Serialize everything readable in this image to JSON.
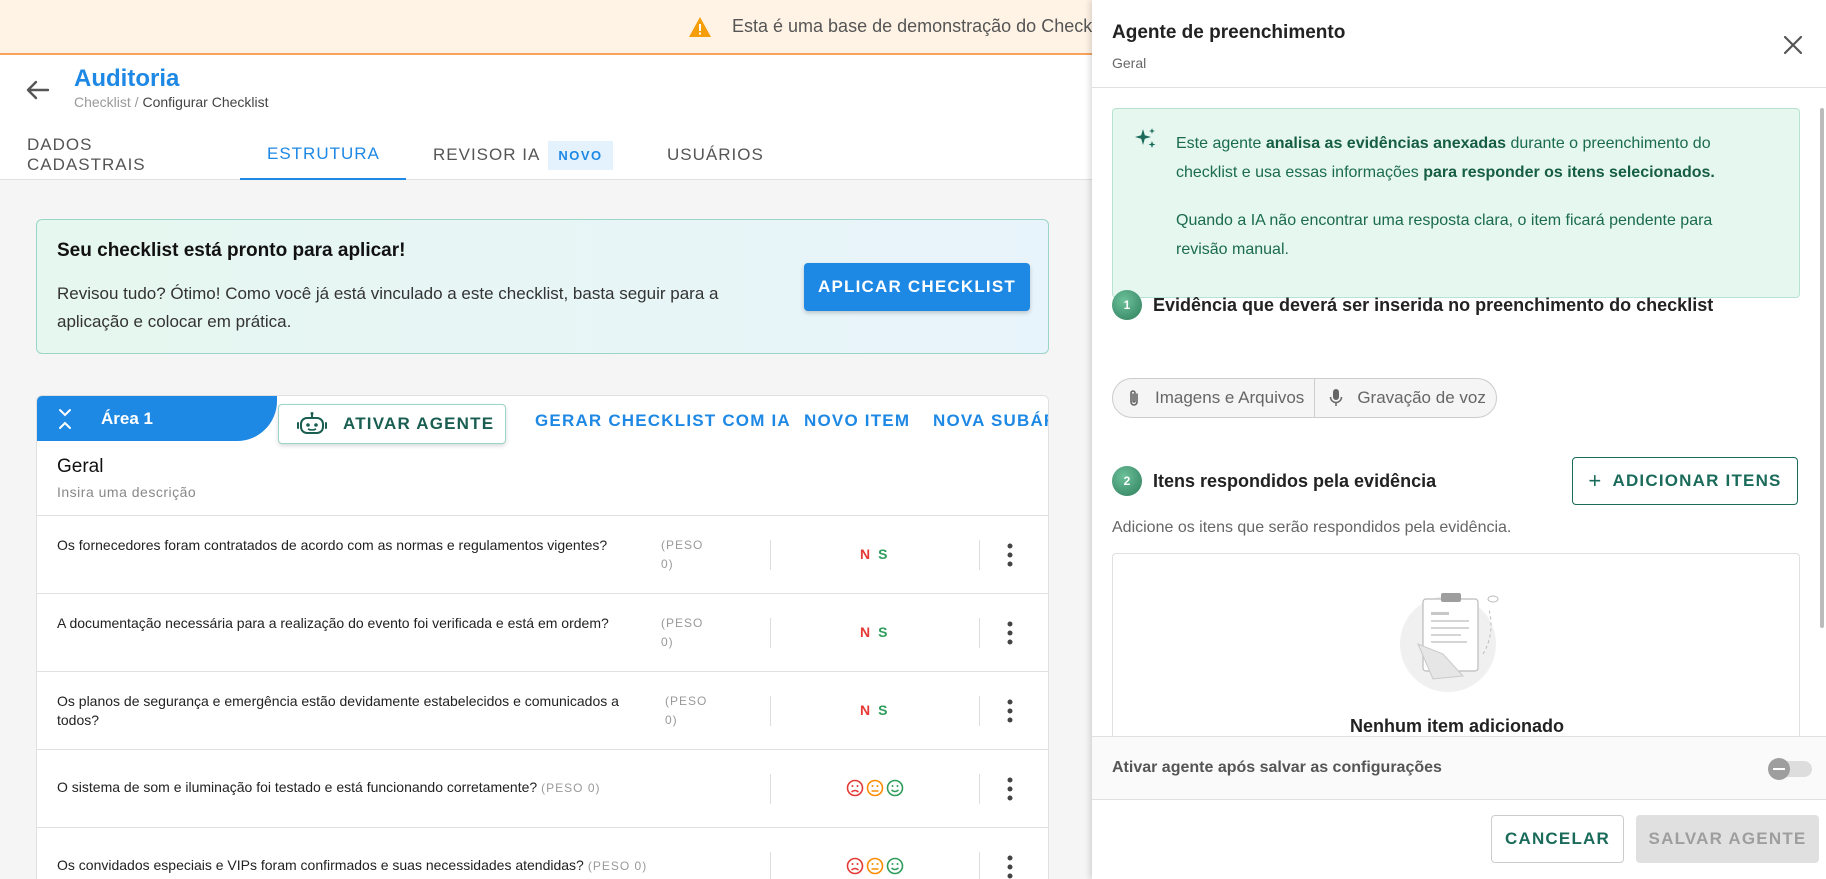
{
  "banner": {
    "text": "Esta é uma base de demonstração do Checkl"
  },
  "header": {
    "title": "Auditoria",
    "breadcrumb_parent": "Checklist",
    "breadcrumb_sep": " / ",
    "breadcrumb_current": "Configurar Checklist"
  },
  "tabs": [
    {
      "label": "DADOS CADASTRAIS"
    },
    {
      "label": "ESTRUTURA",
      "active": true
    },
    {
      "label": "REVISOR IA",
      "badge": "NOVO"
    },
    {
      "label": "USUÁRIOS"
    }
  ],
  "ready_card": {
    "title": "Seu checklist está pronto para aplicar!",
    "text": "Revisou tudo? Ótimo! Como você já está vinculado a este checklist, basta seguir para a aplicação e colocar em prática.",
    "button": "APLICAR CHECKLIST"
  },
  "area": {
    "tab_label": "Área 1",
    "agent_button": "ATIVAR AGENTE",
    "links": [
      "GERAR CHECKLIST COM IA",
      "NOVO ITEM",
      "NOVA SUBÁREA"
    ],
    "section_title": "Geral",
    "section_desc": "Insira uma descrição",
    "items": [
      {
        "question": "Os fornecedores foram contratados de acordo com as normas e regulamentos vigentes?",
        "peso": "(PESO 0)",
        "type": "ns",
        "n": "N",
        "s": "S"
      },
      {
        "question": "A documentação necessária para a realização do evento foi verificada e está em ordem?",
        "peso": "(PESO 0)",
        "type": "ns",
        "n": "N",
        "s": "S"
      },
      {
        "question": "Os planos de segurança e emergência estão devidamente estabelecidos e comunicados a todos?",
        "peso": "(PESO 0)",
        "type": "ns",
        "n": "N",
        "s": "S"
      },
      {
        "question": "O sistema de som e iluminação foi testado e está funcionando corretamente?",
        "peso": "(PESO 0)",
        "type": "faces"
      },
      {
        "question": "Os convidados especiais e VIPs foram confirmados e suas necessidades atendidas?",
        "peso": "(PESO 0)",
        "type": "faces"
      }
    ]
  },
  "drawer": {
    "title": "Agente de preenchimento",
    "subtitle": "Geral",
    "info_p1_a": "Este agente ",
    "info_p1_b": "analisa as evidências anexadas",
    "info_p1_c": " durante o preenchimento do checklist e usa essas informações ",
    "info_p1_d": "para responder os itens selecionados.",
    "info_p2": "Quando a IA não encontrar uma resposta clara, o item ficará pendente para revisão manual.",
    "step1_num": "1",
    "step1_title": "Evidência que deverá ser inserida no preenchimento do checklist",
    "evidence_options": [
      "Imagens e Arquivos",
      "Gravação de voz"
    ],
    "step2_num": "2",
    "step2_title": "Itens respondidos pela evidência",
    "add_button": "ADICIONAR ITENS",
    "add_hint": "Adicione os itens que serão respondidos pela evidência.",
    "empty_text": "Nenhum item adicionado",
    "toggle_label": "Ativar agente após salvar as configurações",
    "cancel_button": "CANCELAR",
    "save_button": "SALVAR AGENTE"
  },
  "colors": {
    "primary": "#1e88e5",
    "agent_green": "#1a6b5a",
    "no_red": "#e53935",
    "yes_green": "#2e9d5b",
    "warning_orange": "#f59e0b"
  }
}
